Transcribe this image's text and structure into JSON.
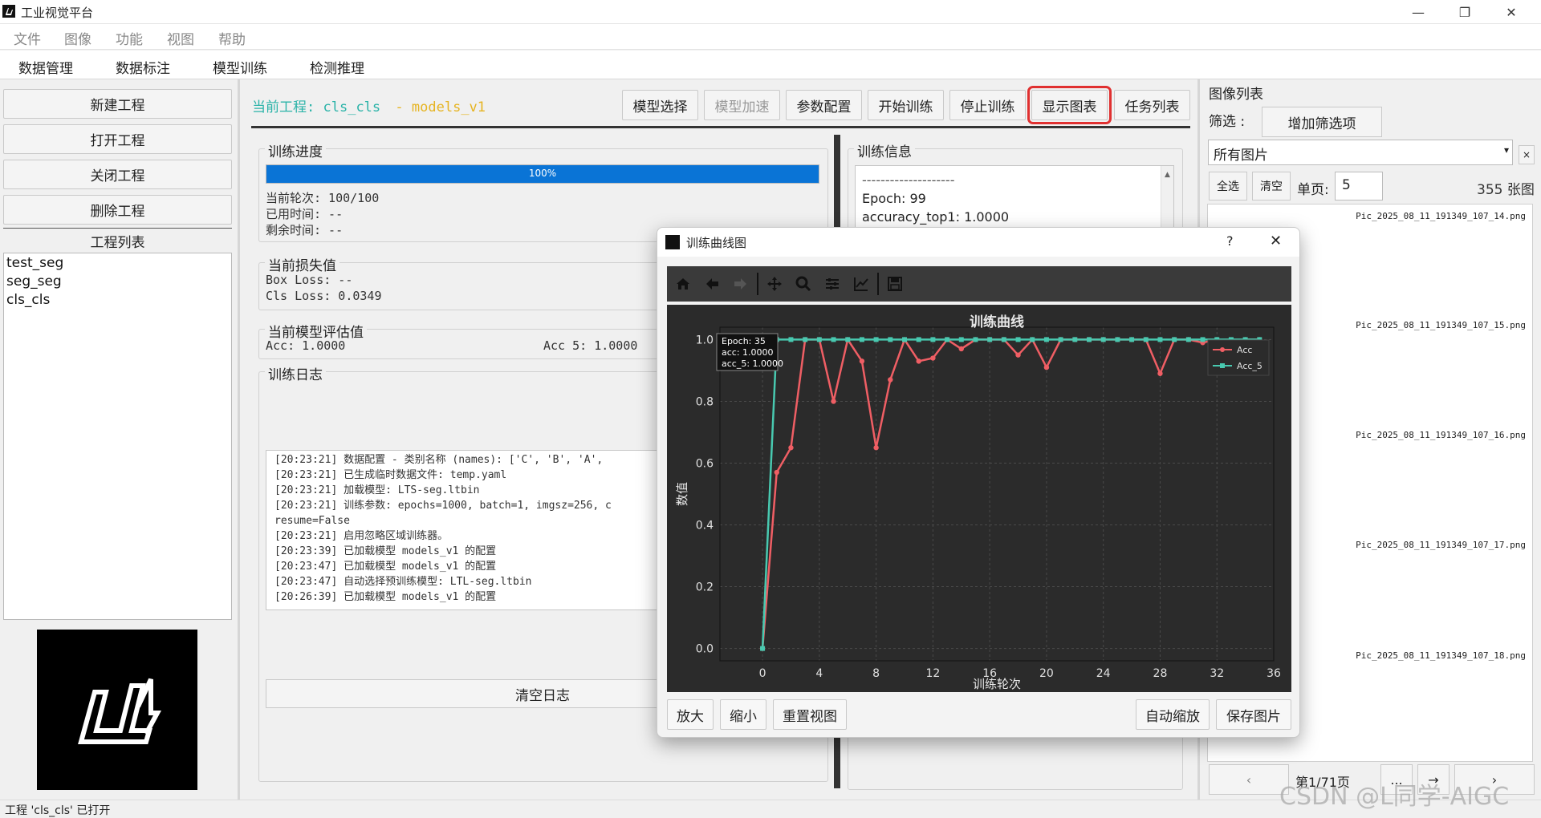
{
  "window": {
    "title": "工业视觉平台"
  },
  "menu": [
    "文件",
    "图像",
    "功能",
    "视图",
    "帮助"
  ],
  "tabs": [
    "数据管理",
    "数据标注",
    "模型训练",
    "检测推理"
  ],
  "project_buttons": [
    "新建工程",
    "打开工程",
    "关闭工程",
    "删除工程"
  ],
  "project_list": {
    "title": "工程列表",
    "items": [
      "test_seg",
      "seg_seg",
      "cls_cls"
    ]
  },
  "header": {
    "current_label": "当前工程:",
    "project": "cls_cls",
    "separator": "-",
    "model": "models_v1"
  },
  "toolbar_buttons": [
    "模型选择",
    "模型加速",
    "参数配置",
    "开始训练",
    "停止训练",
    "显示图表",
    "任务列表"
  ],
  "progress": {
    "title": "训练进度",
    "percent": 100,
    "label": "100%",
    "round": "当前轮次: 100/100",
    "used": "已用时间: --",
    "remaining": "剩余时间: --"
  },
  "loss": {
    "title": "当前损失值",
    "box": "Box Loss: --",
    "cls": "Cls Loss: 0.0349"
  },
  "eval": {
    "title": "当前模型评估值",
    "acc": "Acc: 1.0000",
    "acc5": "Acc 5: 1.0000"
  },
  "log": {
    "title": "训练日志",
    "lines": [
      "[20:23:21] 数据配置 - 类别名称 (names): ['C', 'B', 'A',",
      "[20:23:21] 已生成临时数据文件: temp.yaml",
      "[20:23:21] 加载模型: LTS-seg.ltbin",
      "[20:23:21] 训练参数: epochs=1000, batch=1, imgsz=256, c",
      "resume=False",
      "[20:23:21] 启用忽略区域训练器。",
      "[20:23:39] 已加载模型 models_v1 的配置",
      "[20:23:47] 已加载模型 models_v1 的配置",
      "[20:23:47] 自动选择预训练模型: LTL-seg.ltbin",
      "[20:26:39] 已加载模型 models_v1 的配置"
    ],
    "clear": "清空日志"
  },
  "train_info": {
    "title": "训练信息",
    "dashes": "--------------------",
    "epoch": "Epoch: 99",
    "acc_top1": "accuracy_top1: 1.0000"
  },
  "image_panel": {
    "title": "图像列表",
    "filter_label": "筛选 :",
    "add_filter": "增加筛选项",
    "select_value": "所有图片",
    "clear_x": "×",
    "select_all": "全选",
    "clear": "清空",
    "page_label": "单页:",
    "page_value": "5",
    "count": "355 张图",
    "files": [
      "Pic_2025_08_11_191349_107_14.png",
      "Pic_2025_08_11_191349_107_15.png",
      "Pic_2025_08_11_191349_107_16.png",
      "Pic_2025_08_11_191349_107_17.png",
      "Pic_2025_08_11_191349_107_18.png"
    ],
    "pager": "第1/71页",
    "ellipsis": "..."
  },
  "status": "工程 'cls_cls' 已打开",
  "watermark": "CSDN @L同学-AIGC",
  "dialog": {
    "title": "训练曲线图",
    "help": "?",
    "close": "✕",
    "buttons_left": [
      "放大",
      "缩小",
      "重置视图"
    ],
    "buttons_right": [
      "自动缩放",
      "保存图片"
    ],
    "tooltip": [
      "Epoch: 35",
      "acc: 1.0000",
      "acc_5: 1.0000"
    ]
  },
  "colors": {
    "acc": "#ef5e64",
    "acc5": "#48c9b0",
    "accent": "#0a74d6",
    "highlight": "#e03030"
  },
  "chart_data": {
    "type": "line",
    "title": "训练曲线",
    "xlabel": "训练轮次",
    "ylabel": "数值",
    "xlim": [
      -3,
      36
    ],
    "ylim": [
      -0.04,
      1.04
    ],
    "xticks": [
      0,
      4,
      8,
      12,
      16,
      20,
      24,
      28,
      32,
      36
    ],
    "yticks": [
      0.0,
      0.2,
      0.4,
      0.6,
      0.8,
      1.0
    ],
    "grid": true,
    "legend": "top-right",
    "x": [
      0,
      1,
      2,
      3,
      4,
      5,
      6,
      7,
      8,
      9,
      10,
      11,
      12,
      13,
      14,
      15,
      16,
      17,
      18,
      19,
      20,
      21,
      22,
      23,
      24,
      25,
      26,
      27,
      28,
      29,
      30,
      31,
      32,
      33,
      34,
      35
    ],
    "series": [
      {
        "name": "Acc",
        "values": [
          0.0,
          0.57,
          0.65,
          1.0,
          1.0,
          0.8,
          1.0,
          0.93,
          0.65,
          0.87,
          1.0,
          0.93,
          0.94,
          1.0,
          0.97,
          1.0,
          1.0,
          1.0,
          0.95,
          1.0,
          0.91,
          1.0,
          1.0,
          1.0,
          1.0,
          1.0,
          1.0,
          1.0,
          0.89,
          1.0,
          1.0,
          0.99,
          1.0,
          0.98,
          1.0,
          1.0
        ]
      },
      {
        "name": "Acc_5",
        "values": [
          0.0,
          1.0,
          1.0,
          1.0,
          1.0,
          1.0,
          1.0,
          1.0,
          1.0,
          1.0,
          1.0,
          1.0,
          1.0,
          1.0,
          1.0,
          1.0,
          1.0,
          1.0,
          1.0,
          1.0,
          1.0,
          1.0,
          1.0,
          1.0,
          1.0,
          1.0,
          1.0,
          1.0,
          1.0,
          1.0,
          1.0,
          1.0,
          1.0,
          1.0,
          1.0,
          1.0
        ]
      }
    ]
  }
}
